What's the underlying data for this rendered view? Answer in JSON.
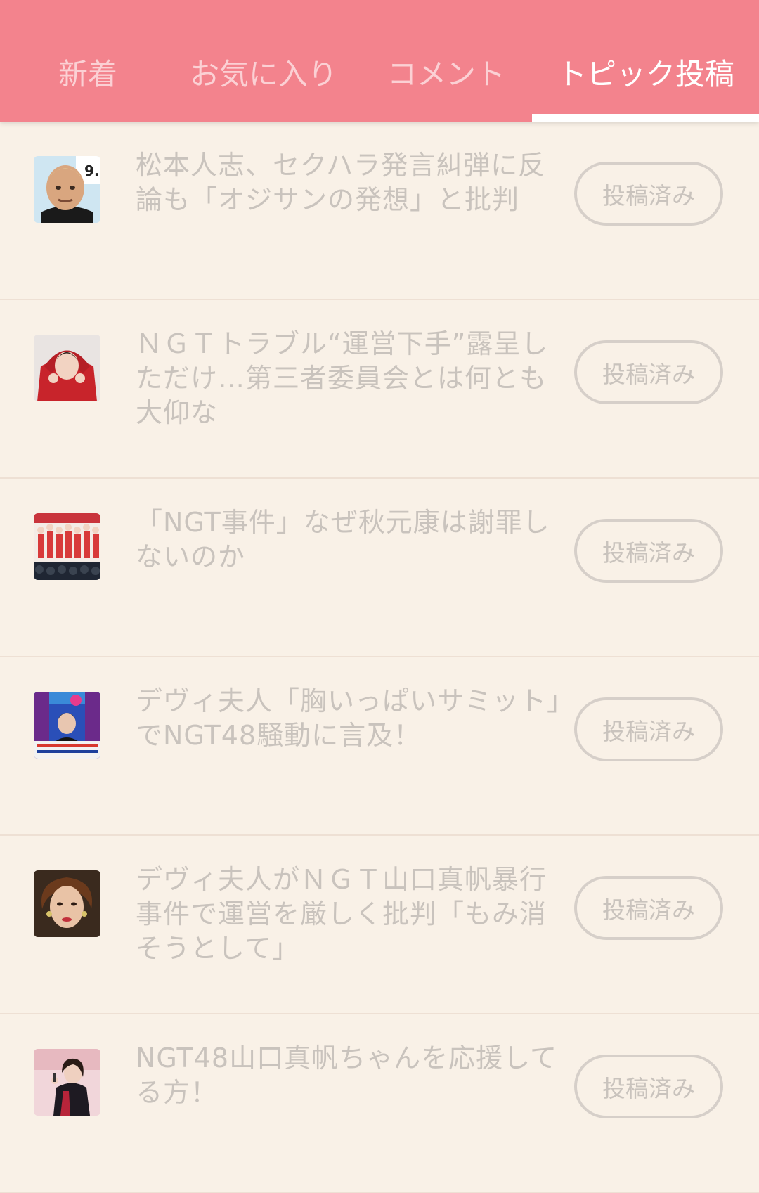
{
  "tabs": [
    {
      "label": "新着"
    },
    {
      "label": "お気に入り"
    },
    {
      "label": "コメント"
    },
    {
      "label": "トピック投稿"
    }
  ],
  "active_tab_index": 3,
  "colors": {
    "header": "#f3838d",
    "background": "#f9f1e7",
    "muted_text": "#c9c3bd"
  },
  "topics": [
    {
      "title": "松本人志、セクハラ発言糾弾に反論も「オジサンの発想」と批判",
      "status": "投稿済み",
      "thumbnail": "man-with-blonde-hair-photo"
    },
    {
      "title": "ＮＧＴトラブル“運営下手”露呈しただけ…第三者委員会とは何とも大仰な",
      "status": "投稿済み",
      "thumbnail": "idol-in-red-jacket-photo"
    },
    {
      "title": "「NGT事件」なぜ秋元康は謝罪しないのか",
      "status": "投稿済み",
      "thumbnail": "idol-group-on-stage-photo"
    },
    {
      "title": "デヴィ夫人「胸いっぱいサミット」でNGT48騒動に言及！",
      "status": "投稿済み",
      "thumbnail": "tv-show-screenshot"
    },
    {
      "title": "デヴィ夫人がＮＧＴ山口真帆暴行事件で運営を厳しく批判「もみ消そうとして」",
      "status": "投稿済み",
      "thumbnail": "woman-portrait-photo"
    },
    {
      "title": "NGT48山口真帆ちゃんを応援してる方！",
      "status": "投稿済み",
      "thumbnail": "idol-performing-photo"
    }
  ]
}
